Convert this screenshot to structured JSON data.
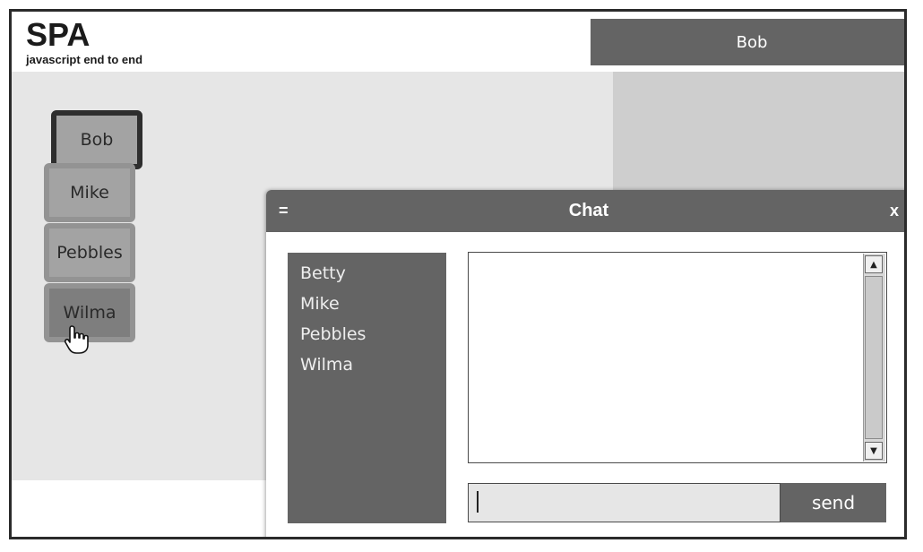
{
  "header": {
    "logo_title": "SPA",
    "logo_subtitle": "javascript end to end",
    "account_name": "Bob"
  },
  "avatars": [
    {
      "label": "Bob",
      "state": "selected"
    },
    {
      "label": "Mike",
      "state": "normal"
    },
    {
      "label": "Pebbles",
      "state": "normal"
    },
    {
      "label": "Wilma",
      "state": "hover"
    }
  ],
  "chat": {
    "toggle_label": "=",
    "title": "Chat",
    "close_label": "x",
    "roster": [
      "Betty",
      "Mike",
      "Pebbles",
      "Wilma"
    ],
    "message_input_value": "",
    "send_label": "send"
  },
  "colors": {
    "bar": "#646464",
    "main_bg": "#e6e6e6",
    "side_bg": "#cecece",
    "avatar_bg": "#a3a3a3",
    "avatar_border": "#939393",
    "selected_border": "#2e2e2e"
  },
  "icons": {
    "cursor": "hand-pointer-icon",
    "scroll_up": "triangle-up-icon",
    "scroll_down": "triangle-down-icon"
  }
}
